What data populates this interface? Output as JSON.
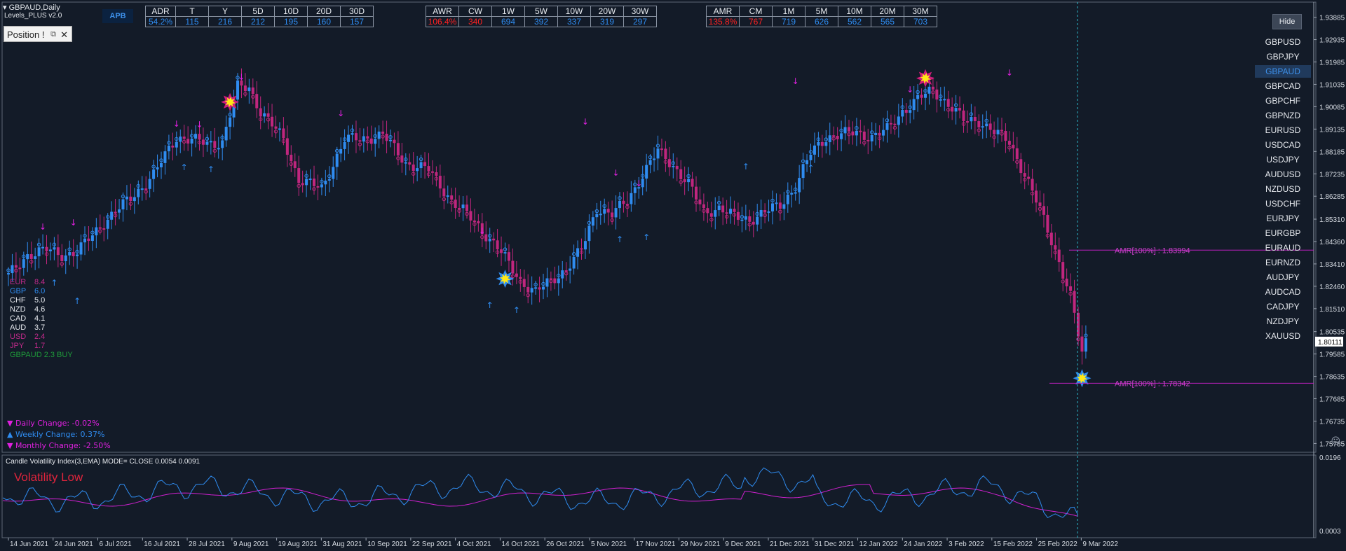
{
  "header": {
    "symbol": "GBPAUD,Daily",
    "indicator": "Levels_PLUS v2.0",
    "position_label": "Position !",
    "apb_label": "APB",
    "hide_label": "Hide"
  },
  "adr_table": {
    "headers": [
      "ADR",
      "T",
      "Y",
      "5D",
      "10D",
      "20D",
      "30D"
    ],
    "values": [
      "54.2%",
      "115",
      "216",
      "212",
      "195",
      "160",
      "157"
    ]
  },
  "awr_table": {
    "headers": [
      "AWR",
      "CW",
      "1W",
      "5W",
      "10W",
      "20W",
      "30W"
    ],
    "values": [
      "106.4%",
      "340",
      "694",
      "392",
      "337",
      "319",
      "297"
    ]
  },
  "amr_table": {
    "headers": [
      "AMR",
      "CM",
      "1M",
      "5M",
      "10M",
      "20M",
      "30M"
    ],
    "values": [
      "135.8%",
      "767",
      "719",
      "626",
      "562",
      "565",
      "703"
    ]
  },
  "symbols": [
    "GBPUSD",
    "GBPJPY",
    "GBPAUD",
    "GBPCAD",
    "GBPCHF",
    "GBPNZD",
    "EURUSD",
    "USDCAD",
    "USDJPY",
    "AUDUSD",
    "NZDUSD",
    "USDCHF",
    "EURJPY",
    "EURGBP",
    "EURAUD",
    "EURNZD",
    "AUDJPY",
    "AUDCAD",
    "CADJPY",
    "NZDJPY",
    "XAUUSD"
  ],
  "active_symbol": "GBPAUD",
  "strength": [
    {
      "cur": "EUR",
      "val": "8.4",
      "color": "#c02a8a"
    },
    {
      "cur": "GBP",
      "val": "6.0",
      "color": "#2f8cf0"
    },
    {
      "cur": "CHF",
      "val": "5.0",
      "color": "#e6e9ee"
    },
    {
      "cur": "NZD",
      "val": "4.6",
      "color": "#e6e9ee"
    },
    {
      "cur": "CAD",
      "val": "4.1",
      "color": "#e6e9ee"
    },
    {
      "cur": "AUD",
      "val": "3.7",
      "color": "#e6e9ee"
    },
    {
      "cur": "USD",
      "val": "2.4",
      "color": "#c02a8a"
    },
    {
      "cur": "JPY",
      "val": "1.7",
      "color": "#c02a8a"
    }
  ],
  "signal": "GBPAUD 2.3 BUY",
  "changes": [
    {
      "text": "▼ Daily Change: -0.02%",
      "color": "#e020e0"
    },
    {
      "text": "▲ Weekly Change: 0.37%",
      "color": "#2f8cf0"
    },
    {
      "text": "▼ Monthly Change: -2.50%",
      "color": "#e020e0"
    }
  ],
  "volatility": {
    "title": "Candle Volatility Index(3,EMA) MODE= CLOSE 0.0054 0.0091",
    "status": "Volatility Low",
    "ylabels": [
      "0.0196",
      "0.0003"
    ]
  },
  "chart_data": {
    "type": "candlestick",
    "title": "GBPAUD,Daily",
    "y_ticks": [
      "1.93885",
      "1.92935",
      "1.91985",
      "1.91035",
      "1.90085",
      "1.89135",
      "1.88185",
      "1.87235",
      "1.86285",
      "1.85310",
      "1.84360",
      "1.83410",
      "1.82460",
      "1.81510",
      "1.80535",
      "1.79585",
      "1.78635",
      "1.77685",
      "1.76735",
      "1.75785"
    ],
    "ylim": [
      1.755,
      1.942
    ],
    "x_labels": [
      "14 Jun 2021",
      "24 Jun 2021",
      "6 Jul 2021",
      "16 Jul 2021",
      "28 Jul 2021",
      "9 Aug 2021",
      "19 Aug 2021",
      "31 Aug 2021",
      "10 Sep 2021",
      "22 Sep 2021",
      "4 Oct 2021",
      "14 Oct 2021",
      "26 Oct 2021",
      "5 Nov 2021",
      "17 Nov 2021",
      "29 Nov 2021",
      "9 Dec 2021",
      "21 Dec 2021",
      "31 Dec 2021",
      "12 Jan 2022",
      "24 Jan 2022",
      "3 Feb 2022",
      "15 Feb 2022",
      "25 Feb 2022",
      "9 Mar 2022"
    ],
    "current_price": "1.80111",
    "levels": [
      {
        "label": "AMR[100%] : 1.83994",
        "value": 1.83994
      },
      {
        "label": "AMR[100%] : 1.78342",
        "value": 1.78342
      }
    ],
    "close_path": [
      [
        0,
        1.829
      ],
      [
        5,
        1.838
      ],
      [
        10,
        1.84
      ],
      [
        14,
        1.838
      ],
      [
        18,
        1.839
      ],
      [
        25,
        1.852
      ],
      [
        32,
        1.862
      ],
      [
        38,
        1.872
      ],
      [
        44,
        1.888
      ],
      [
        48,
        1.887
      ],
      [
        52,
        1.885
      ],
      [
        56,
        1.886
      ],
      [
        60,
        1.909
      ],
      [
        63,
        1.909
      ],
      [
        66,
        1.899
      ],
      [
        72,
        1.887
      ],
      [
        76,
        1.87
      ],
      [
        82,
        1.866
      ],
      [
        88,
        1.887
      ],
      [
        92,
        1.887
      ],
      [
        98,
        1.889
      ],
      [
        104,
        1.877
      ],
      [
        110,
        1.874
      ],
      [
        116,
        1.861
      ],
      [
        122,
        1.852
      ],
      [
        128,
        1.841
      ],
      [
        134,
        1.827
      ],
      [
        138,
        1.822
      ],
      [
        142,
        1.827
      ],
      [
        146,
        1.832
      ],
      [
        150,
        1.84
      ],
      [
        154,
        1.858
      ],
      [
        158,
        1.855
      ],
      [
        162,
        1.861
      ],
      [
        166,
        1.872
      ],
      [
        170,
        1.882
      ],
      [
        174,
        1.876
      ],
      [
        178,
        1.868
      ],
      [
        182,
        1.856
      ],
      [
        186,
        1.858
      ],
      [
        190,
        1.854
      ],
      [
        194,
        1.853
      ],
      [
        198,
        1.856
      ],
      [
        202,
        1.859
      ],
      [
        206,
        1.867
      ],
      [
        210,
        1.881
      ],
      [
        214,
        1.888
      ],
      [
        218,
        1.889
      ],
      [
        222,
        1.89
      ],
      [
        226,
        1.888
      ],
      [
        230,
        1.891
      ],
      [
        234,
        1.899
      ],
      [
        238,
        1.904
      ],
      [
        242,
        1.908
      ],
      [
        246,
        1.902
      ],
      [
        250,
        1.895
      ],
      [
        254,
        1.895
      ],
      [
        258,
        1.89
      ],
      [
        262,
        1.886
      ],
      [
        266,
        1.872
      ],
      [
        270,
        1.857
      ],
      [
        274,
        1.84
      ],
      [
        278,
        1.82
      ],
      [
        281,
        1.796
      ],
      [
        282,
        1.801
      ]
    ],
    "volatility_series": [
      {
        "name": "fast",
        "color": "#2f8cf0"
      },
      {
        "name": "slow",
        "color": "#d020d0"
      }
    ]
  }
}
